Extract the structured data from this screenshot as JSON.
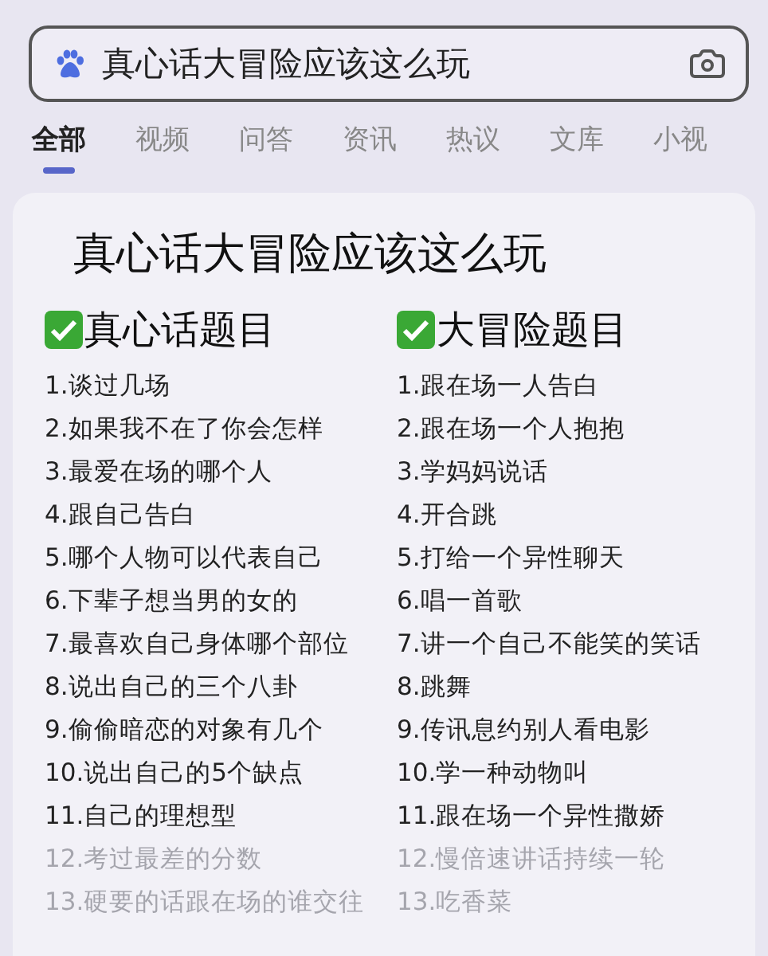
{
  "search": {
    "value": "真心话大冒险应该这么玩"
  },
  "tabs": [
    {
      "label": "全部",
      "selected": true
    },
    {
      "label": "视频",
      "selected": false
    },
    {
      "label": "问答",
      "selected": false
    },
    {
      "label": "资讯",
      "selected": false
    },
    {
      "label": "热议",
      "selected": false
    },
    {
      "label": "文库",
      "selected": false
    },
    {
      "label": "小视",
      "selected": false
    }
  ],
  "card": {
    "title": "真心话大冒险应该这么玩",
    "columns": [
      {
        "heading": "真心话题目",
        "items": [
          {
            "text": "1.谈过几场",
            "faded": false
          },
          {
            "text": "2.如果我不在了你会怎样",
            "faded": false
          },
          {
            "text": "3.最爱在场的哪个人",
            "faded": false
          },
          {
            "text": "4.跟自己告白",
            "faded": false
          },
          {
            "text": "5.哪个人物可以代表自己",
            "faded": false
          },
          {
            "text": "6.下辈子想当男的女的",
            "faded": false
          },
          {
            "text": "7.最喜欢自己身体哪个部位",
            "faded": false
          },
          {
            "text": "8.说出自己的三个八卦",
            "faded": false
          },
          {
            "text": "9.偷偷暗恋的对象有几个",
            "faded": false
          },
          {
            "text": "10.说出自己的5个缺点",
            "faded": false
          },
          {
            "text": "11.自己的理想型",
            "faded": false
          },
          {
            "text": "12.考过最差的分数",
            "faded": true
          },
          {
            "text": "13.硬要的话跟在场的谁交往",
            "faded": true
          }
        ]
      },
      {
        "heading": "大冒险题目",
        "items": [
          {
            "text": "1.跟在场一人告白",
            "faded": false
          },
          {
            "text": "2.跟在场一个人抱抱",
            "faded": false
          },
          {
            "text": "3.学妈妈说话",
            "faded": false
          },
          {
            "text": "4.开合跳",
            "faded": false
          },
          {
            "text": "5.打给一个异性聊天",
            "faded": false
          },
          {
            "text": "6.唱一首歌",
            "faded": false
          },
          {
            "text": "7.讲一个自己不能笑的笑话",
            "faded": false
          },
          {
            "text": "8.跳舞",
            "faded": false
          },
          {
            "text": "9.传讯息约别人看电影",
            "faded": false
          },
          {
            "text": "10.学一种动物叫",
            "faded": false
          },
          {
            "text": "11.跟在场一个异性撒娇",
            "faded": false
          },
          {
            "text": "12.慢倍速讲话持续一轮",
            "faded": true
          },
          {
            "text": "13.吃香菜",
            "faded": true
          }
        ]
      }
    ]
  }
}
